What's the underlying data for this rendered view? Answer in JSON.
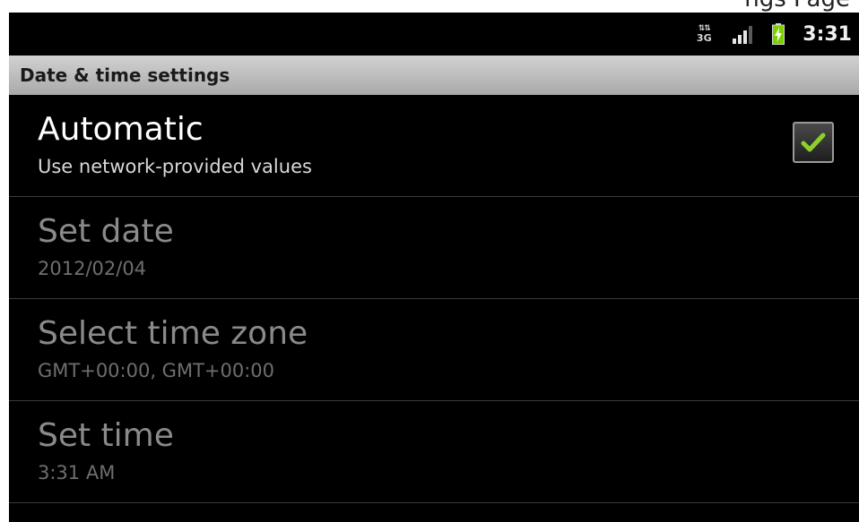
{
  "page_top_text": "ngs Page",
  "status_bar": {
    "network_label": "3G",
    "network_icon": "3g-data-icon",
    "signal_icon": "signal-strength-icon",
    "battery_icon": "battery-charging-icon",
    "time": "3:31"
  },
  "title_bar": {
    "title": "Date & time settings"
  },
  "preferences": [
    {
      "title": "Automatic",
      "summary": "Use network-provided values",
      "checked": true,
      "enabled": true
    },
    {
      "title": "Set date",
      "summary": "2012/02/04",
      "enabled": false
    },
    {
      "title": "Select time zone",
      "summary": "GMT+00:00, GMT+00:00",
      "enabled": false
    },
    {
      "title": "Set time",
      "summary": "3:31 AM",
      "enabled": false
    }
  ],
  "colors": {
    "background": "#000000",
    "title_bar": "#bcbcbc",
    "checkmark": "#8ad22a",
    "battery": "#7cd000"
  }
}
